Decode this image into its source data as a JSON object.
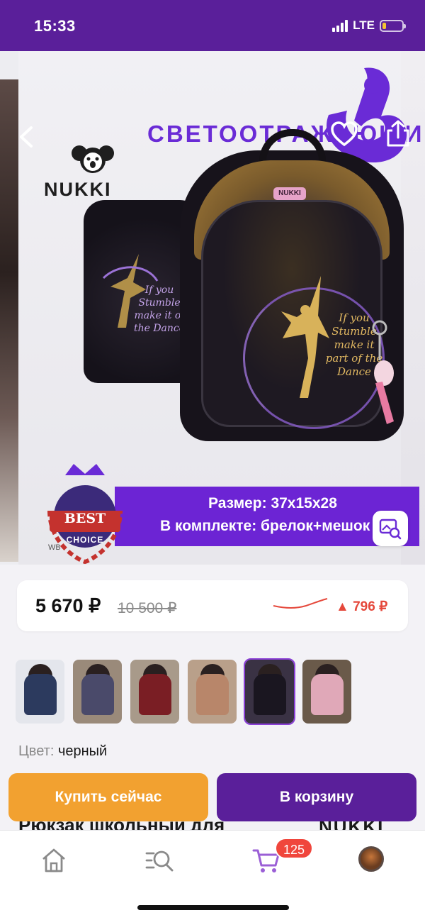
{
  "status_bar": {
    "time": "15:33",
    "network": "LTE",
    "battery_level": 0.2,
    "battery_color": "#f4c430"
  },
  "hero": {
    "reflective_text": "СВЕТООТРАЖАЮЩИЙ",
    "brand": "NUKKI",
    "bag_tag": "NUKKI",
    "bag_back_text": "If you Stumble make it of the Dance",
    "bag_front_text": "If you Stumble make it part of the Dance",
    "size_text": "Размер: 37х15х28",
    "kit_text": "В комплекте: брелок+мешок",
    "badge_best": "BEST",
    "badge_choice": "CHOICE",
    "watermark": "WB",
    "icons": {
      "back": "chevron-left-icon",
      "favorite": "heart-icon",
      "share": "share-icon",
      "visual_search": "image-search-icon"
    }
  },
  "price": {
    "current": "5 670 ₽",
    "old": "10 500 ₽",
    "change": "▲ 796 ₽",
    "change_color": "#e5483b"
  },
  "thumbnails": [
    {
      "label": "thumb-1",
      "bg": "#e4e6ec",
      "accent": "#2c3a5e",
      "selected": false
    },
    {
      "label": "thumb-2",
      "bg": "#9a8a7a",
      "accent": "#4a4a6a",
      "selected": false
    },
    {
      "label": "thumb-3",
      "bg": "#a89a8a",
      "accent": "#7a1e24",
      "selected": false
    },
    {
      "label": "thumb-4",
      "bg": "#b9a08a",
      "accent": "#b8866a",
      "selected": false
    },
    {
      "label": "thumb-5",
      "bg": "#3a3244",
      "accent": "#1a1620",
      "selected": true
    },
    {
      "label": "thumb-6",
      "bg": "#6a5a4a",
      "accent": "#e0a8b8",
      "selected": false
    }
  ],
  "color": {
    "label": "Цвет:",
    "value": "черный"
  },
  "title_peek": "Рюкзак школьный для",
  "title_logo_peek": "NUKKI",
  "actions": {
    "buy_now": "Купить сейчас",
    "add_to_cart": "В корзину"
  },
  "tabbar": {
    "cart_count": "125",
    "icons": [
      "home-icon",
      "catalog-search-icon",
      "cart-icon",
      "profile-avatar"
    ]
  },
  "colors": {
    "brand_purple": "#5a1f9a",
    "accent_violet": "#6c24d4",
    "buy_orange": "#f2a130"
  }
}
